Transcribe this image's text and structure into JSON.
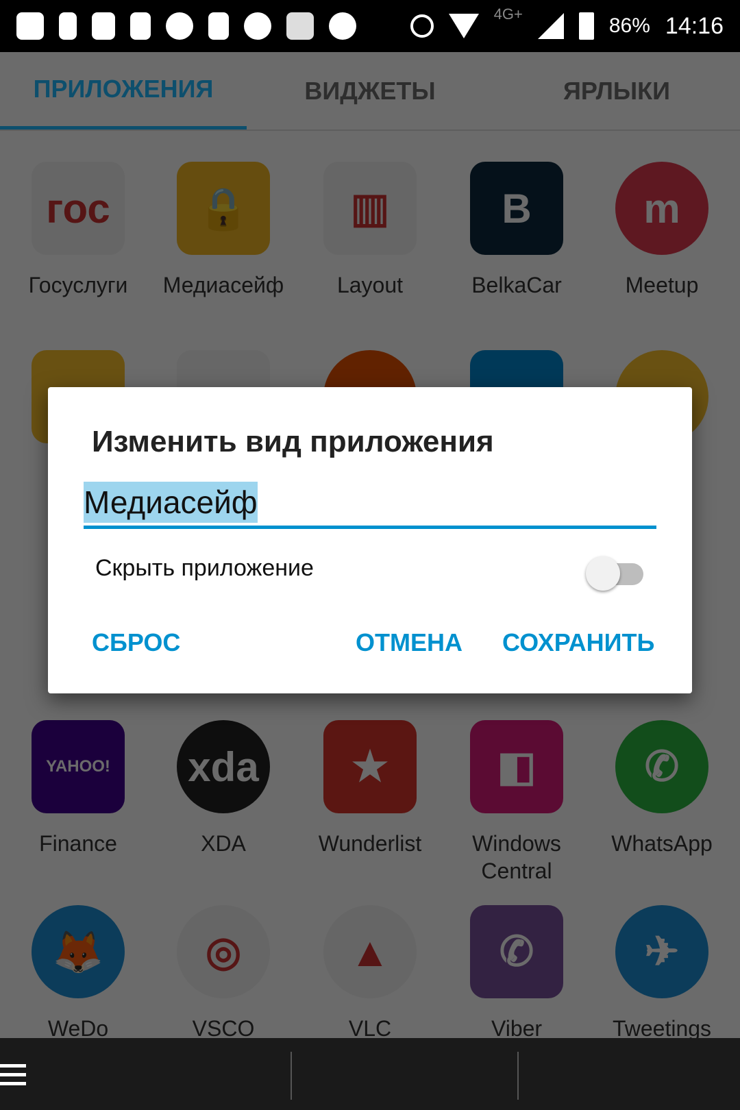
{
  "status_bar": {
    "battery": "86%",
    "time": "14:16",
    "network": "4G+",
    "icons": [
      "chat-icon",
      "flag-icon",
      "belkacar-icon",
      "rss-icon",
      "emoji-icon",
      "id-icon",
      "emoji-icon",
      "flipboard-icon",
      "emoji-icon",
      "alarm-icon",
      "wifi-icon",
      "signal-icon",
      "battery-icon"
    ]
  },
  "tabs": [
    {
      "label": "ПРИЛОЖЕНИЯ",
      "active": true
    },
    {
      "label": "ВИДЖЕТЫ"
    },
    {
      "label": "ЯРЛЫКИ"
    }
  ],
  "apps_row1": [
    {
      "label": "Госуслуги",
      "color": "#f2f2f2",
      "glyph": "гос"
    },
    {
      "label": "Медиасейф",
      "color": "#f2b825",
      "glyph": "🔒"
    },
    {
      "label": "Layout",
      "color": "#f4f4f4",
      "glyph": "▥"
    },
    {
      "label": "BelkaCar",
      "color": "#0d2a3e",
      "glyph": "B"
    },
    {
      "label": "Meetup",
      "color": "#e0394f",
      "glyph": "m"
    }
  ],
  "apps_row4": [
    {
      "label": "Finance",
      "color": "#400090",
      "glyph": "YAHOO!"
    },
    {
      "label": "XDA",
      "color": "#222",
      "glyph": "xda"
    },
    {
      "label": "Wunderlist",
      "color": "#d9362b",
      "glyph": "★"
    },
    {
      "label": "Windows Central",
      "color": "#d81b7a",
      "glyph": "◧"
    },
    {
      "label": "WhatsApp",
      "color": "#2bb741",
      "glyph": "✆"
    }
  ],
  "apps_row5": [
    {
      "label": "WeDo",
      "color": "#1e8fd6",
      "glyph": "🦊"
    },
    {
      "label": "VSCO",
      "color": "#f2f2f2",
      "glyph": "◎"
    },
    {
      "label": "VLC",
      "color": "#f2f2f2",
      "glyph": "▲"
    },
    {
      "label": "Viber",
      "color": "#7b519d",
      "glyph": "✆"
    },
    {
      "label": "Tweetings",
      "color": "#1e8fd6",
      "glyph": "✈"
    }
  ],
  "dialog": {
    "title": "Изменить вид приложения",
    "name_value": "Медиасейф",
    "hide_label": "Скрыть приложение",
    "hide_enabled": false,
    "reset": "СБРОС",
    "cancel": "ОТМЕНА",
    "save": "СОХРАНИТЬ"
  },
  "accent": "#0091cf"
}
